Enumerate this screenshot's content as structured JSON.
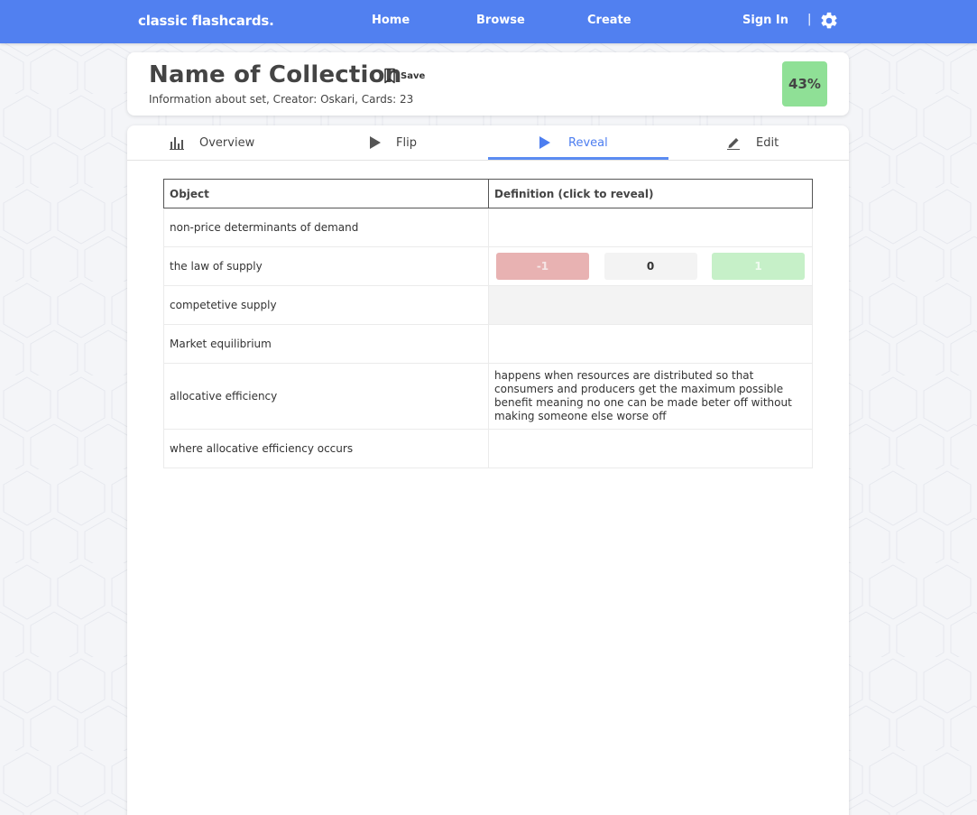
{
  "nav": {
    "brand": "classic flashcards.",
    "links": [
      "Home",
      "Browse",
      "Create"
    ],
    "sign_in": "Sign In",
    "separator": "|",
    "settings_icon": "gear-icon",
    "color": "#5180f0"
  },
  "collection": {
    "title": "Name of Collection",
    "save_label": "Save",
    "info": "Information about set, Creator: Oskari, Cards: 23",
    "progress": "43%",
    "progress_color": "#8fe096"
  },
  "tabs": [
    {
      "label": "Overview",
      "icon": "bar-chart-icon"
    },
    {
      "label": "Flip",
      "icon": "play-icon"
    },
    {
      "label": "Reveal",
      "icon": "play-icon",
      "active": true
    },
    {
      "label": "Edit",
      "icon": "pencil-icon"
    }
  ],
  "table": {
    "headers": [
      "Object",
      "Definition (click to reveal)"
    ],
    "rows": [
      {
        "object": "non-price determinants of demand",
        "definition": ""
      },
      {
        "object": "the law of supply",
        "definition": "",
        "votes": [
          "-1",
          "0",
          "1"
        ]
      },
      {
        "object": "competetive supply",
        "definition": ""
      },
      {
        "object": "Market equilibrium",
        "definition": ""
      },
      {
        "object": "allocative efficiency",
        "definition": "happens when resources are distributed so that consumers and producers get the maximum possible benefit meaning no one can be made beter off without making someone else worse off"
      },
      {
        "object": "where allocative efficiency occurs",
        "definition": ""
      }
    ]
  }
}
